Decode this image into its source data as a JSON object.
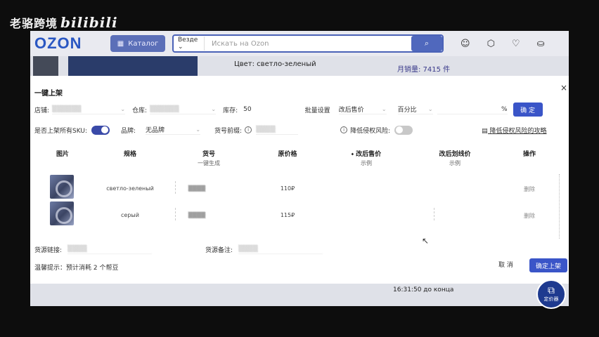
{
  "watermark": {
    "channel": "老骆跨境",
    "logo": "bilibili"
  },
  "ozon": {
    "logo": "OZON",
    "catalog_label": "Каталог",
    "search": {
      "scope": "Везде",
      "placeholder": "Искать на Ozon"
    },
    "icons": [
      "smile-icon",
      "box-icon",
      "heart-icon",
      "bag-icon"
    ],
    "color_line": "Цвет: светло-зеленый",
    "monthly_sales": "月销量: 7415 件",
    "timer": "16:31:50 до конца"
  },
  "modal": {
    "title": "一键上架",
    "close": "×",
    "shop_label": "店铺:",
    "shop_value": "",
    "warehouse_label": "仓库:",
    "warehouse_value": "",
    "stock_label": "库存:",
    "stock_value": "50",
    "batch_label": "批量设置",
    "after_price_label": "改后售价",
    "percent_label": "百分比",
    "percent_sign": "%",
    "confirm_label": "确 定",
    "all_sku_label": "是否上架所有SKU:",
    "all_sku_on": true,
    "brand_label": "品牌:",
    "brand_value": "无品牌",
    "sku_prefix_label": "货号前缀:",
    "sku_prefix_value": "",
    "reduce_risk_label": "降低侵权风险:",
    "reduce_risk_on": false,
    "link_text": "降低侵权风险的攻略"
  },
  "table": {
    "headers": [
      {
        "label": "图片",
        "sub": ""
      },
      {
        "label": "规格",
        "sub": ""
      },
      {
        "label": "货号",
        "sub": "一键生成"
      },
      {
        "label": "原价格",
        "sub": ""
      },
      {
        "label": "改后售价",
        "sub": "示例"
      },
      {
        "label": "改后划线价",
        "sub": "示例"
      },
      {
        "label": "操作",
        "sub": ""
      }
    ],
    "rows": [
      {
        "spec": "светло-зеленый",
        "sku": "",
        "price": "110₽",
        "action": "删除"
      },
      {
        "spec": "серый",
        "sku": "",
        "price": "115₽",
        "action": "删除"
      }
    ]
  },
  "source": {
    "link_label": "货源链接:",
    "link_value": "",
    "note_label": "货源备注:",
    "note_value": ""
  },
  "footer": {
    "tip": "温馨提示：预计消耗 2 个帮豆",
    "cancel": "取 消",
    "confirm": "确定上架"
  },
  "fab": {
    "label": "定价器"
  }
}
